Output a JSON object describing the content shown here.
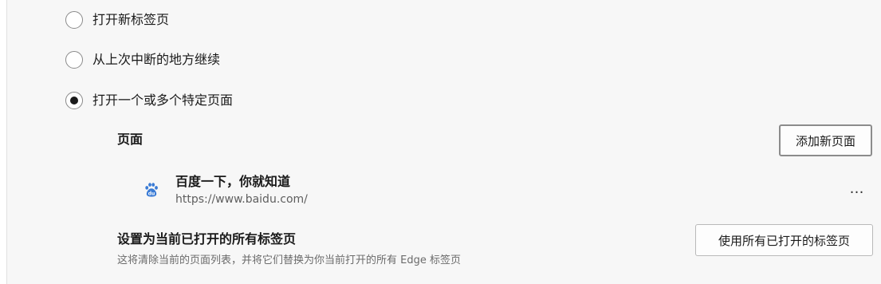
{
  "startup_options": [
    {
      "label": "打开新标签页",
      "checked": false
    },
    {
      "label": "从上次中断的地方继续",
      "checked": false
    },
    {
      "label": "打开一个或多个特定页面",
      "checked": true
    }
  ],
  "pages": {
    "title": "页面",
    "add_button_label": "添加新页面",
    "items": [
      {
        "title": "百度一下，你就知道",
        "url": "https://www.baidu.com/",
        "icon": "baidu-paw-icon",
        "more_label": "…"
      }
    ]
  },
  "set_current": {
    "title": "设置为当前已打开的所有标签页",
    "description": "这将清除当前的页面列表，并将它们替换为你当前打开的所有 Edge 标签页",
    "button_label": "使用所有已打开的标签页"
  },
  "colors": {
    "background": "#f7f7f7",
    "favicon_blue": "#3a7bd5"
  }
}
